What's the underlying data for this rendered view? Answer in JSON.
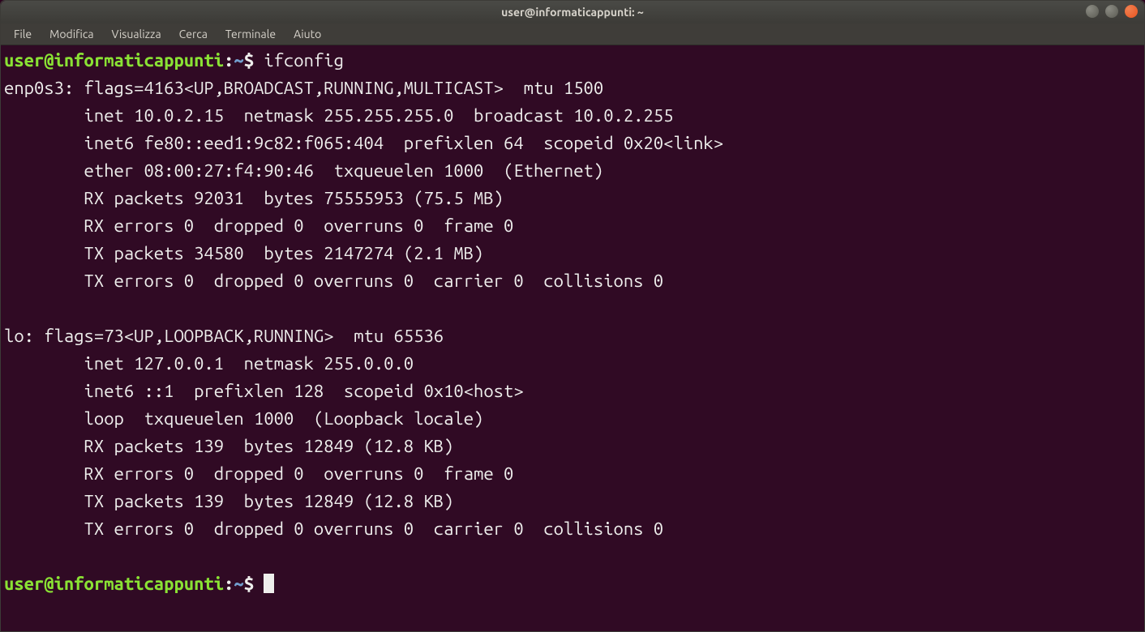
{
  "window": {
    "title": "user@informaticappunti: ~"
  },
  "menu": {
    "file": "File",
    "edit": "Modifica",
    "view": "Visualizza",
    "search": "Cerca",
    "terminal": "Terminale",
    "help": "Aiuto"
  },
  "prompt": {
    "userhost": "user@informaticappunti",
    "sep1": ":",
    "path": "~",
    "sep2": "$ "
  },
  "cmd": {
    "ifconfig": "ifconfig"
  },
  "out": {
    "l01": "enp0s3: flags=4163<UP,BROADCAST,RUNNING,MULTICAST>  mtu 1500",
    "l02": "        inet 10.0.2.15  netmask 255.255.255.0  broadcast 10.0.2.255",
    "l03": "        inet6 fe80::eed1:9c82:f065:404  prefixlen 64  scopeid 0x20<link>",
    "l04": "        ether 08:00:27:f4:90:46  txqueuelen 1000  (Ethernet)",
    "l05": "        RX packets 92031  bytes 75555953 (75.5 MB)",
    "l06": "        RX errors 0  dropped 0  overruns 0  frame 0",
    "l07": "        TX packets 34580  bytes 2147274 (2.1 MB)",
    "l08": "        TX errors 0  dropped 0 overruns 0  carrier 0  collisions 0",
    "l09": "",
    "l10": "lo: flags=73<UP,LOOPBACK,RUNNING>  mtu 65536",
    "l11": "        inet 127.0.0.1  netmask 255.0.0.0",
    "l12": "        inet6 ::1  prefixlen 128  scopeid 0x10<host>",
    "l13": "        loop  txqueuelen 1000  (Loopback locale)",
    "l14": "        RX packets 139  bytes 12849 (12.8 KB)",
    "l15": "        RX errors 0  dropped 0  overruns 0  frame 0",
    "l16": "        TX packets 139  bytes 12849 (12.8 KB)",
    "l17": "        TX errors 0  dropped 0 overruns 0  carrier 0  collisions 0",
    "l18": ""
  }
}
